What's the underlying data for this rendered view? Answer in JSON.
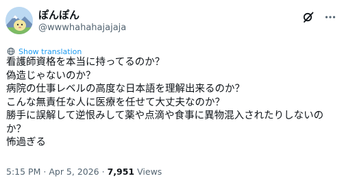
{
  "post": {
    "display_name": "ぽんぽん",
    "handle": "@wwwhahahajajaja",
    "translate_label": "Show translation",
    "lines": [
      "看護師資格を本当に持ってるのか？",
      "偽造じゃないのか？",
      "病院の仕事レベルの高度な日本語を理解出来るのか？",
      "こんな無責任な人に医療を任せて大丈夫なのか？",
      "勝手に誤解して逆恨みして薬や点滴や食事に異物混入されたりしないの",
      "か？",
      "怖過ぎる"
    ],
    "time": "5:15 PM",
    "separator": "·",
    "date": "Apr 5, 2026",
    "views_count": "7,951",
    "views_label": "Views"
  },
  "icons": {
    "grok": "grok-icon",
    "more": "more-icon",
    "translate": "globe-icon"
  },
  "colors": {
    "text": "#0f1419",
    "secondary": "#536471",
    "link": "#1d9bf0"
  }
}
